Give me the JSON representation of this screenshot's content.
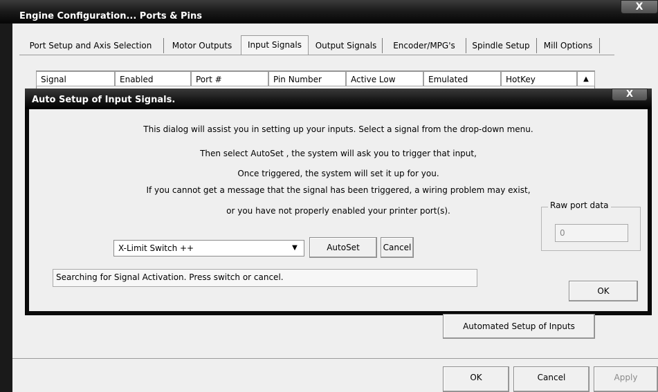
{
  "window": {
    "title": "Engine Configuration... Ports & Pins",
    "close": "X"
  },
  "tabs": [
    {
      "label": "Port Setup and Axis Selection"
    },
    {
      "label": "Motor Outputs"
    },
    {
      "label": "Input Signals"
    },
    {
      "label": "Output Signals"
    },
    {
      "label": "Encoder/MPG's"
    },
    {
      "label": "Spindle Setup"
    },
    {
      "label": "Mill Options"
    }
  ],
  "table": {
    "columns": [
      "Signal",
      "Enabled",
      "Port #",
      "Pin Number",
      "Active Low",
      "Emulated",
      "HotKey"
    ],
    "sort_arrow": "▲"
  },
  "dialog": {
    "title": "Auto Setup of Input Signals.",
    "close": "X",
    "lines": [
      "This dialog will assist you in setting up your inputs. Select a signal from the drop-down menu.",
      "Then select AutoSet , the system will ask you to trigger that input,",
      "Once triggered, the system will set it up for you.",
      "If you cannot get a message that the signal has been triggered, a wiring problem may exist,",
      "or you have not properly enabled your printer port(s)."
    ],
    "raw_port_label": "Raw port data",
    "raw_port_value": "0",
    "signal_selected": "X-Limit Switch ++",
    "select_arrow": "▼",
    "autoset_label": "AutoSet",
    "cancel_label": "Cancel",
    "status_text": "Searching for Signal Activation. Press switch or cancel.",
    "ok_label": "OK"
  },
  "buttons": {
    "automated_setup": "Automated Setup of Inputs",
    "ok": "OK",
    "cancel": "Cancel",
    "apply": "Apply"
  }
}
